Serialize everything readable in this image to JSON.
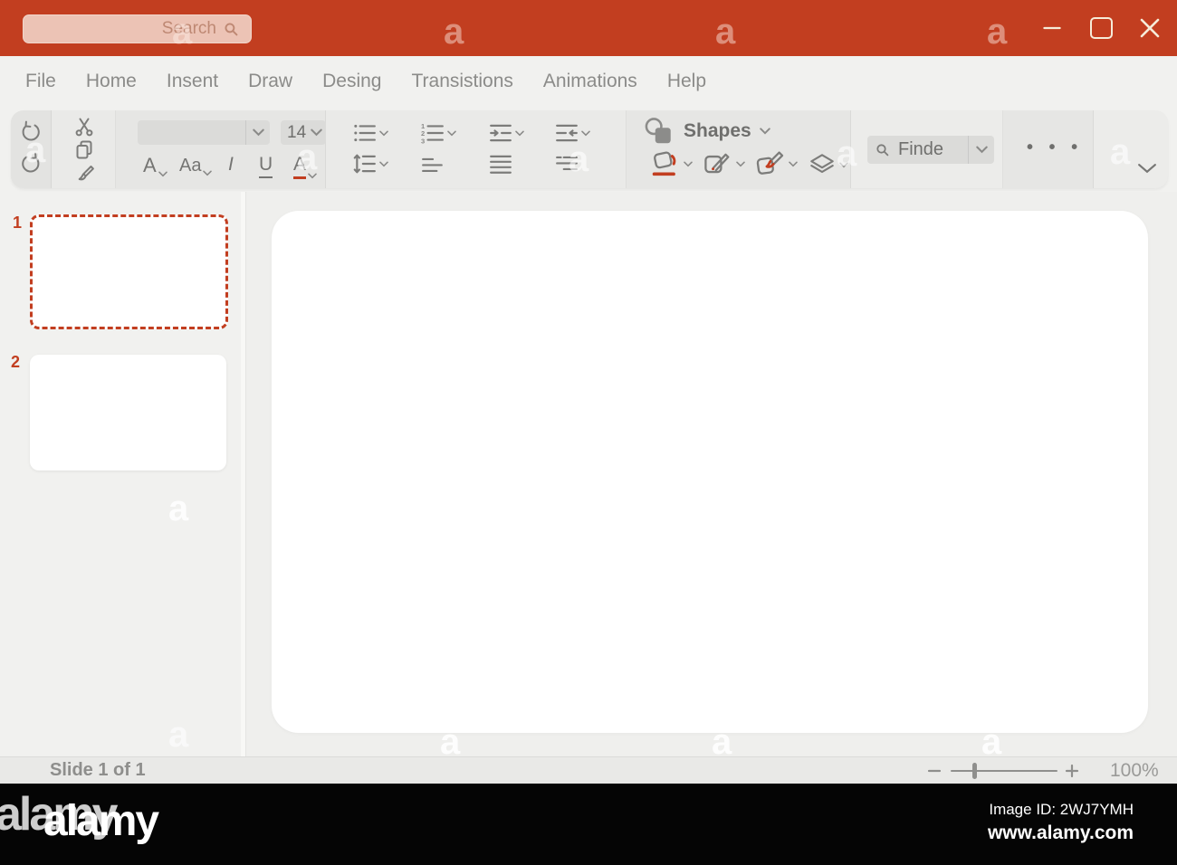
{
  "titlebar": {
    "search": {
      "placeholder": "Search",
      "value": ""
    }
  },
  "menu": {
    "items": [
      "File",
      "Home",
      "Insent",
      "Draw",
      "Desing",
      "Transistions",
      "Animations",
      "Help"
    ]
  },
  "ribbon": {
    "font_name_value": "",
    "font_size_value": "14",
    "text_buttons": {
      "grow_font": "A",
      "change_case": "Aa",
      "italic": "I",
      "underline": "U",
      "font_color": "A"
    },
    "shapes_label": "Shapes",
    "find_label": "Finde",
    "more_label": "• • •"
  },
  "slides_panel": {
    "items": [
      {
        "number": "1",
        "selected": true
      },
      {
        "number": "2",
        "selected": false
      }
    ]
  },
  "status_bar": {
    "slide_indicator": "Slide 1 of 1",
    "zoom_percent": "100%"
  },
  "watermark": {
    "letter": "a",
    "brand": "alamy",
    "image_id_line": "Image ID: 2WJ7YMH",
    "site_line": "www.alamy.com"
  },
  "icons": {
    "search_icon": "magnifier",
    "minimize_icon": "horizontal line",
    "maximize_icon": "rounded square outline",
    "close_icon": "x cross",
    "undo_icon": "counterclockwise arrow",
    "redo_icon": "clockwise arrow",
    "cut_icon": "scissors",
    "copy_icon": "two pages",
    "format_painter_icon": "paint brush",
    "bullet_list_icon": "dots with lines",
    "numbered_list_icon": "1 2 3 with lines",
    "indent_increase_icon": "lines with right arrow",
    "indent_decrease_icon": "lines with left arrow",
    "line_spacing_icon": "vertical arrows with lines",
    "align_left_icon": "left lines",
    "justify_icon": "equal lines",
    "align_right_icon": "right lines",
    "shapes_icon": "circle and square",
    "shape_fill_icon": "tilted square with red pour",
    "shape_outline_icon": "square with pencil",
    "shape_effects_icon": "square with red brush",
    "merge_shapes_icon": "stacked layers",
    "find_icon": "magnifier",
    "more_icon": "ellipsis",
    "collapse_ribbon_icon": "chevron down",
    "zoom_out_icon": "minus",
    "zoom_in_icon": "plus"
  },
  "colors": {
    "accent_red": "#C23E20",
    "titlebar_red": "#C23E20",
    "ribbon_bg": "#E7E7E5",
    "icon_gray": "#7C7C7A",
    "canvas_white": "#FFFFFF"
  }
}
